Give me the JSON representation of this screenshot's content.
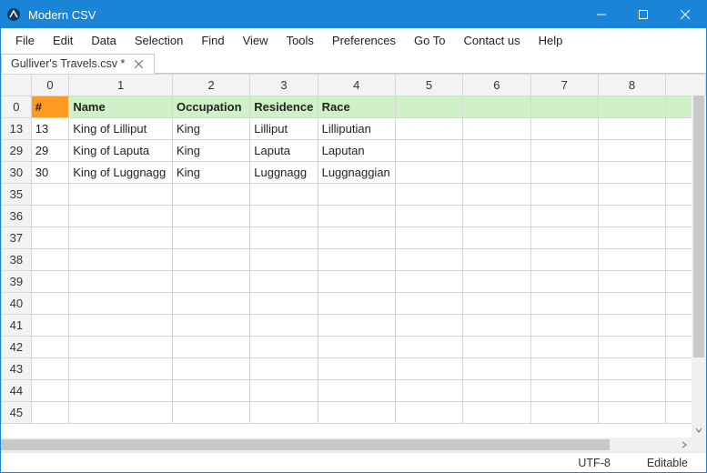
{
  "window": {
    "title": "Modern CSV"
  },
  "menu": {
    "items": [
      "File",
      "Edit",
      "Data",
      "Selection",
      "Find",
      "View",
      "Tools",
      "Preferences",
      "Go To",
      "Contact us",
      "Help"
    ]
  },
  "tab": {
    "label": "Gulliver's Travels.csv *"
  },
  "sheet": {
    "col_headers": [
      "0",
      "1",
      "2",
      "3",
      "4",
      "5",
      "6",
      "7",
      "8"
    ],
    "row_headers": [
      "0",
      "13",
      "29",
      "30",
      "35",
      "36",
      "37",
      "38",
      "39",
      "40",
      "41",
      "42",
      "43",
      "44",
      "45"
    ],
    "header_row": [
      "#",
      "Name",
      "Occupation",
      "Residence",
      "Race"
    ],
    "data_rows": [
      [
        "13",
        "King of Lilliput",
        "King",
        "Lilliput",
        "Lilliputian"
      ],
      [
        "29",
        "King of Laputa",
        "King",
        "Laputa",
        "Laputan"
      ],
      [
        "30",
        "King of Luggnagg",
        "King",
        "Luggnagg",
        "Luggnaggian"
      ]
    ]
  },
  "status": {
    "encoding": "UTF-8",
    "mode": "Editable"
  }
}
